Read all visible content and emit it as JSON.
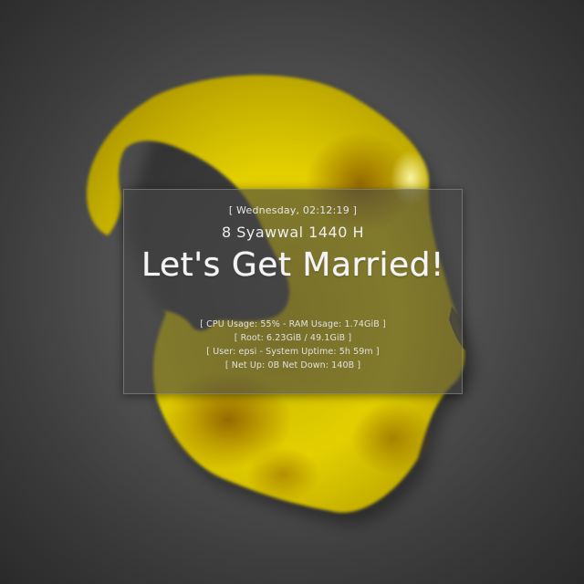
{
  "desktop": {
    "background_color": "#4a4a4a",
    "accent_color": "#e8d800"
  },
  "conky": {
    "clock_line": "[ Wednesday, 02:12:19 ]",
    "hijri_date": "8 Syawwal 1440 H",
    "headline": "Let's Get Married!",
    "stats": {
      "cpu_ram": "[ CPU Usage: 55% - RAM Usage: 1.74GiB ]",
      "root": "[ Root: 6.23GiB / 49.1GiB ]",
      "user_uptime": "[ User: epsi - System Uptime: 5h 59m ]",
      "net": "[ Net Up: 0B   Net Down: 140B   ]"
    }
  }
}
